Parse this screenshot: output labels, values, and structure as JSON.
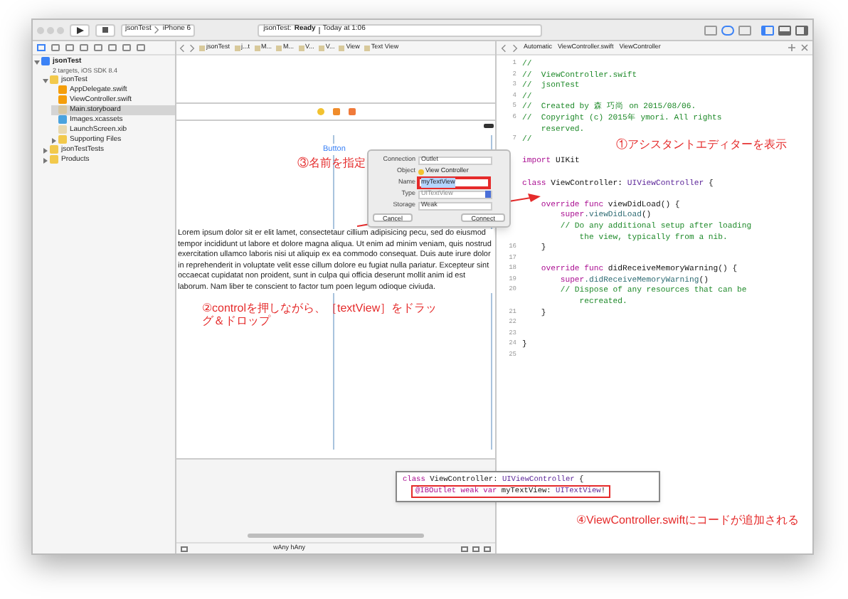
{
  "toolbar": {
    "scheme": "jsonTest",
    "device": "iPhone 6",
    "status_project": "jsonTest:",
    "status_state": "Ready",
    "status_time": "Today at 1:06"
  },
  "storyboard_jump_bar": [
    "jsonTest",
    "j...t",
    "M...",
    "M...",
    "V...",
    "V...",
    "View",
    "Text View"
  ],
  "editor_jump_bar": [
    "Automatic",
    "ViewController.swift",
    "ViewController"
  ],
  "navigator": [
    {
      "name": "jsonTest",
      "subtitle": "2 targets, iOS SDK 8.4",
      "kind": "project",
      "expanded": true,
      "selected": false,
      "children": [
        {
          "name": "jsonTest",
          "kind": "folder",
          "expanded": true,
          "selected": false,
          "children": [
            {
              "name": "AppDelegate.swift",
              "kind": "swift",
              "selected": false
            },
            {
              "name": "ViewController.swift",
              "kind": "swift",
              "selected": false
            },
            {
              "name": "Main.storyboard",
              "kind": "storyboard",
              "selected": true
            },
            {
              "name": "Images.xcassets",
              "kind": "assets",
              "selected": false
            },
            {
              "name": "LaunchScreen.xib",
              "kind": "xib",
              "selected": false
            },
            {
              "name": "Supporting Files",
              "kind": "folder",
              "expanded": false,
              "selected": false
            }
          ]
        },
        {
          "name": "jsonTestTests",
          "kind": "folder",
          "expanded": false,
          "selected": false
        },
        {
          "name": "Products",
          "kind": "folder",
          "expanded": false,
          "selected": false
        }
      ]
    }
  ],
  "scene": {
    "button": "Button",
    "text": "Lorem ipsum dolor sit er elit lamet, consectetaur cillium adipisicing pecu, sed do eiusmod tempor incididunt ut labore et dolore magna aliqua. Ut enim ad minim veniam, quis nostrud exercitation ullamco laboris nisi ut aliquip ex ea commodo consequat. Duis aute irure dolor in reprehenderit in voluptate velit esse cillum dolore eu fugiat nulla pariatur. Excepteur sint occaecat cupidatat non proident, sunt in culpa qui officia deserunt mollit anim id est laborum. Nam liber te conscient to factor tum poen legum odioque civiuda.",
    "size_class": "wAny hAny"
  },
  "connection_popup": {
    "rows": [
      {
        "label": "Connection",
        "value": "Outlet",
        "kind": "select"
      },
      {
        "label": "Object",
        "value": "View Controller",
        "kind": "object"
      },
      {
        "label": "Name",
        "value": "myTextView",
        "kind": "input"
      },
      {
        "label": "Type",
        "value": "UITextView",
        "kind": "combo"
      },
      {
        "label": "Storage",
        "value": "Weak",
        "kind": "select"
      }
    ],
    "buttons": [
      "Cancel",
      "Connect"
    ]
  },
  "code": [
    {
      "number": "1",
      "tokens": [
        {
          "kind": "comment",
          "text": "//"
        }
      ]
    },
    {
      "number": "2",
      "tokens": [
        {
          "kind": "comment",
          "text": "//  ViewController.swift"
        }
      ]
    },
    {
      "number": "3",
      "tokens": [
        {
          "kind": "comment",
          "text": "//  jsonTest"
        }
      ]
    },
    {
      "number": "4",
      "tokens": [
        {
          "kind": "comment",
          "text": "//"
        }
      ]
    },
    {
      "number": "5",
      "tokens": [
        {
          "kind": "comment",
          "text": "//  Created by 森 巧尚 on 2015/08/06."
        }
      ]
    },
    {
      "number": "6",
      "tokens": [
        {
          "kind": "comment",
          "text": "//  Copyright (c) 2015年 ymori. All rights"
        }
      ]
    },
    {
      "tokens": [
        {
          "kind": "comment",
          "text": "    reserved."
        }
      ]
    },
    {
      "number": "7",
      "tokens": [
        {
          "kind": "comment",
          "text": "//"
        }
      ]
    },
    {
      "space_before": true,
      "tokens": [
        {
          "kind": "keyword",
          "text": "import"
        },
        {
          "kind": "plain",
          "text": " UIKit"
        }
      ]
    },
    {
      "space_before": true,
      "tokens": [
        {
          "kind": "keyword",
          "text": "class"
        },
        {
          "kind": "plain",
          "text": " ViewController: "
        },
        {
          "kind": "type",
          "text": "UIViewController"
        },
        {
          "kind": "plain",
          "text": " {"
        }
      ]
    },
    {
      "space_before": true,
      "tokens": [
        {
          "kind": "keyword",
          "text": "    override func"
        },
        {
          "kind": "plain",
          "text": " viewDidLoad() {"
        }
      ]
    },
    {
      "tokens": [
        {
          "kind": "keyword",
          "text": "        super"
        },
        {
          "kind": "call",
          "text": ".viewDidLoad"
        },
        {
          "kind": "plain",
          "text": "()"
        }
      ]
    },
    {
      "tokens": [
        {
          "kind": "comment",
          "text": "        // Do any additional setup after loading"
        }
      ]
    },
    {
      "tokens": [
        {
          "kind": "comment",
          "text": "            the view, typically from a nib."
        }
      ]
    },
    {
      "number": "16",
      "tokens": [
        {
          "kind": "plain",
          "text": "    }"
        }
      ]
    },
    {
      "number": "17"
    },
    {
      "number": "18",
      "tokens": [
        {
          "kind": "keyword",
          "text": "    override func"
        },
        {
          "kind": "plain",
          "text": " didReceiveMemoryWarning() {"
        }
      ]
    },
    {
      "number": "19",
      "tokens": [
        {
          "kind": "keyword",
          "text": "        super"
        },
        {
          "kind": "call",
          "text": ".didReceiveMemoryWarning"
        },
        {
          "kind": "plain",
          "text": "()"
        }
      ]
    },
    {
      "number": "20",
      "tokens": [
        {
          "kind": "comment",
          "text": "        // Dispose of any resources that can be"
        }
      ]
    },
    {
      "tokens": [
        {
          "kind": "comment",
          "text": "            recreated."
        }
      ]
    },
    {
      "number": "21",
      "tokens": [
        {
          "kind": "plain",
          "text": "    }"
        }
      ]
    },
    {
      "number": "22"
    },
    {
      "number": "23"
    },
    {
      "number": "24",
      "tokens": [
        {
          "kind": "plain",
          "text": "}"
        }
      ]
    },
    {
      "number": "25"
    }
  ],
  "code_callout": [
    {
      "tokens": [
        {
          "kind": "keyword",
          "text": "class"
        },
        {
          "kind": "plain",
          "text": " ViewController: "
        },
        {
          "kind": "type",
          "text": "UIViewController"
        },
        {
          "kind": "plain",
          "text": " {"
        }
      ]
    },
    {
      "tokens": [
        {
          "kind": "keyword",
          "text": "@IBOutlet weak var"
        },
        {
          "kind": "plain",
          "text": " myTextView: "
        },
        {
          "kind": "type",
          "text": "UITextView"
        },
        {
          "kind": "plain",
          "text": "!"
        }
      ]
    }
  ],
  "annotations": [
    "①アシスタントエディターを表示",
    "③名前を指定",
    "②controlを押しながら、［textView］をドラッグ＆ドロップ",
    "④ViewController.swiftにコードが追加される"
  ]
}
